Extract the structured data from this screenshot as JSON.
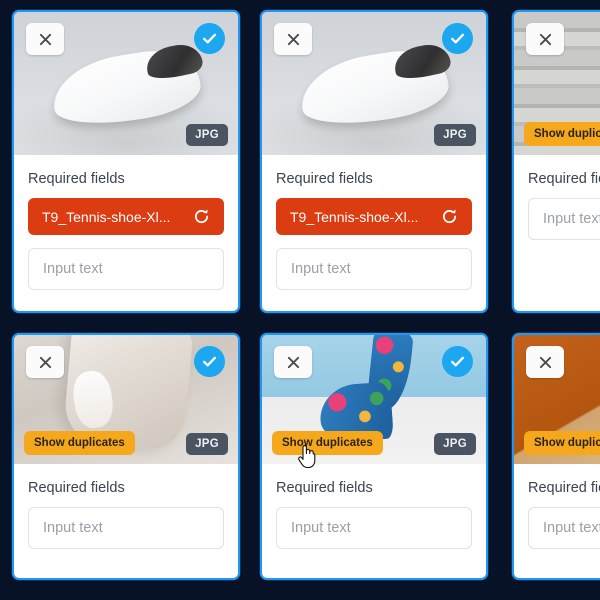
{
  "app": {
    "background_color": "#081227",
    "card_border_color": "#2196f3",
    "accent_select_color": "#1ca7f0",
    "chip_color": "#dc3c11",
    "duplicate_badge_color": "#f5a81c",
    "type_badge_color": "#4b5462"
  },
  "labels": {
    "required_fields": "Required fields",
    "input_placeholder": "Input text",
    "show_duplicates": "Show duplicates",
    "file_type": "JPG",
    "chip_value": "T9_Tennis-shoe-Xl...",
    "close_icon": "close-icon",
    "check_icon": "check-icon",
    "refresh_icon": "refresh-icon",
    "cursor_icon": "pointer-hand-cursor"
  },
  "cards": [
    {
      "id": "card-1",
      "photo": "ph-shoe-white",
      "selected": true,
      "has_duplicates": false,
      "has_chip": true,
      "file_type": "JPG",
      "chip_value": "T9_Tennis-shoe-Xl...",
      "required_fields_label": "Required fields",
      "input_placeholder": "Input text"
    },
    {
      "id": "card-2",
      "photo": "ph-shoe-white",
      "selected": true,
      "has_duplicates": false,
      "has_chip": true,
      "file_type": "JPG",
      "chip_value": "T9_Tennis-shoe-Xl...",
      "required_fields_label": "Required fields",
      "input_placeholder": "Input text"
    },
    {
      "id": "card-3",
      "photo": "ph-stairs",
      "selected": false,
      "has_duplicates": true,
      "has_chip": false,
      "duplicates_label": "Show duplicates",
      "required_fields_label": "Required fields",
      "input_placeholder": "Input text"
    },
    {
      "id": "card-4",
      "photo": "ph-sneaker-beige",
      "selected": true,
      "has_duplicates": true,
      "has_chip": false,
      "file_type": "JPG",
      "duplicates_label": "Show duplicates",
      "required_fields_label": "Required fields",
      "input_placeholder": "Input text"
    },
    {
      "id": "card-5",
      "photo": "ph-floral",
      "selected": true,
      "has_duplicates": true,
      "has_chip": false,
      "file_type": "JPG",
      "duplicates_label": "Show duplicates",
      "required_fields_label": "Required fields",
      "input_placeholder": "Input text"
    },
    {
      "id": "card-6",
      "photo": "ph-orange",
      "selected": false,
      "has_duplicates": true,
      "has_chip": false,
      "duplicates_label": "Show duplicates",
      "required_fields_label": "Required fields",
      "input_placeholder": "Input text"
    }
  ]
}
